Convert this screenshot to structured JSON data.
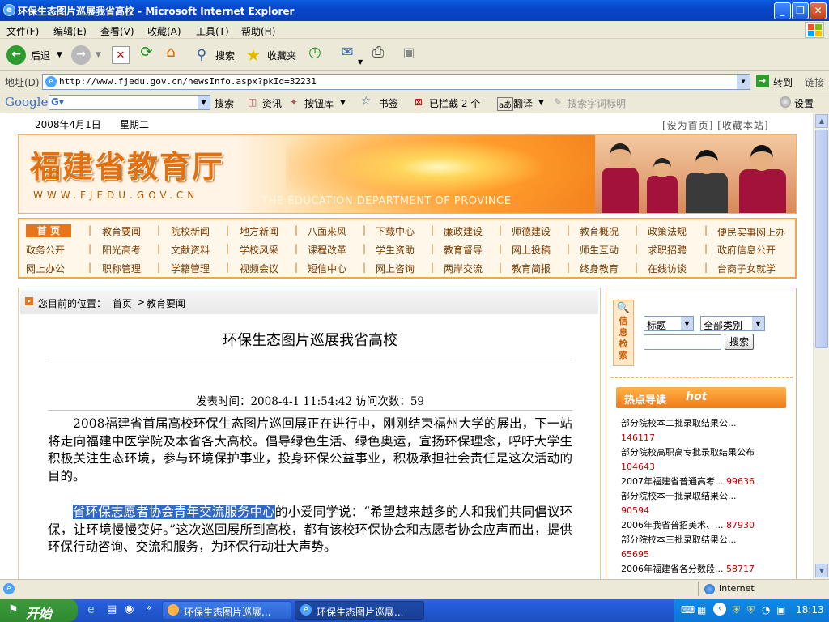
{
  "window": {
    "title": "环保生态图片巡展我省高校 - Microsoft Internet Explorer"
  },
  "menu": [
    "文件(F)",
    "编辑(E)",
    "查看(V)",
    "收藏(A)",
    "工具(T)",
    "帮助(H)"
  ],
  "toolbar": {
    "back": "后退",
    "search": "搜索",
    "favorites": "收藏夹"
  },
  "address": {
    "label": "地址(D)",
    "url": "http://www.fjedu.gov.cn/newsInfo.aspx?pkId=32231",
    "go": "转到",
    "links": "链接"
  },
  "google": {
    "logo": "Google",
    "search": "搜索",
    "news": "资讯",
    "rank": "按钮库",
    "bookmarks": "书签",
    "blocked": "已拦截 2 个",
    "translate": "翻译",
    "highlight": "搜索字词标明",
    "settings": "设置"
  },
  "page": {
    "date": "2008年4月1日",
    "weekday": "星期二",
    "top_links": "[设为首页] [收藏本站]",
    "site_name": "福建省教育厅",
    "site_url": "WWW.FJEDU.GOV.CN",
    "banner_en": "THE EDUCATION DEPARTMENT OF PROVINCE",
    "nav_rows": [
      [
        "首 页",
        "教育要闻",
        "院校新闻",
        "地方新闻",
        "八面来风",
        "下载中心",
        "廉政建设",
        "师德建设",
        "教育概况",
        "政策法规",
        "便民实事网上办"
      ],
      [
        "政务公开",
        "阳光高考",
        "文献资料",
        "学校风采",
        "课程改革",
        "学生资助",
        "教育督导",
        "网上投稿",
        "师生互动",
        "求职招聘",
        "政府信息公开"
      ],
      [
        "网上办公",
        "职称管理",
        "学籍管理",
        "视频会议",
        "短信中心",
        "网上咨询",
        "两岸交流",
        "教育简报",
        "终身教育",
        "在线访谈",
        "台商子女就学"
      ]
    ],
    "breadcrumb": {
      "prefix": "您目前的位置：",
      "home": "首页",
      "sep": ">",
      "current": "教育要闻"
    },
    "article": {
      "title": "环保生态图片巡展我省高校",
      "meta": "发表时间：2008-4-1 11:54:42 访问次数：59",
      "p1": "2008福建省首届高校环保生态图片巡回展正在进行中，刚刚结束福州大学的展出，下一站将走向福建中医学院及本省各大高校。倡导绿色生活、绿色奥运，宣扬环保理念，呼吁大学生积极关注生态环境，参与环境保护事业，投身环保公益事业，积极承担社会责任是这次活动的目的。",
      "p2_highlight": "省环保志愿者协会青年交流服务中心",
      "p2_rest": "的小爱同学说：“希望越来越多的人和我们共同倡议环保，让环境慢慢变好。”这次巡回展所到高校，都有该校环保协会和志愿者协会应声而出，提供环保行动咨询、交流和服务，为环保行动壮大声势。"
    },
    "search_panel": {
      "label": "信息检索",
      "field": "标题",
      "category": "全部类别",
      "button": "搜索"
    },
    "hot": {
      "header": "热点导读",
      "header_en": "hot",
      "items": [
        {
          "title": "部分院校本二批录取结果公...",
          "count": "146117"
        },
        {
          "title": "部分院校高职高专批录取结果公布",
          "count": "104643"
        },
        {
          "title": "2007年福建省普通高考...",
          "count": "99636"
        },
        {
          "title": "部分院校本一批录取结果公...",
          "count": "90594"
        },
        {
          "title": "2006年我省普招美术、...",
          "count": "87930"
        },
        {
          "title": "部分院校本三批录取结果公...",
          "count": "65695"
        },
        {
          "title": "2006年福建省各分数段...",
          "count": "58717"
        }
      ]
    }
  },
  "status": {
    "zone": "Internet"
  },
  "taskbar": {
    "start": "开始",
    "task1": "环保生态图片巡展...",
    "task2": "环保生态图片巡展...",
    "time": "18:13"
  },
  "colors": {
    "accent": "#e8741c",
    "nav_text": "#7a3b00",
    "link_red": "#c00000",
    "xp_blue": "#245edb"
  }
}
